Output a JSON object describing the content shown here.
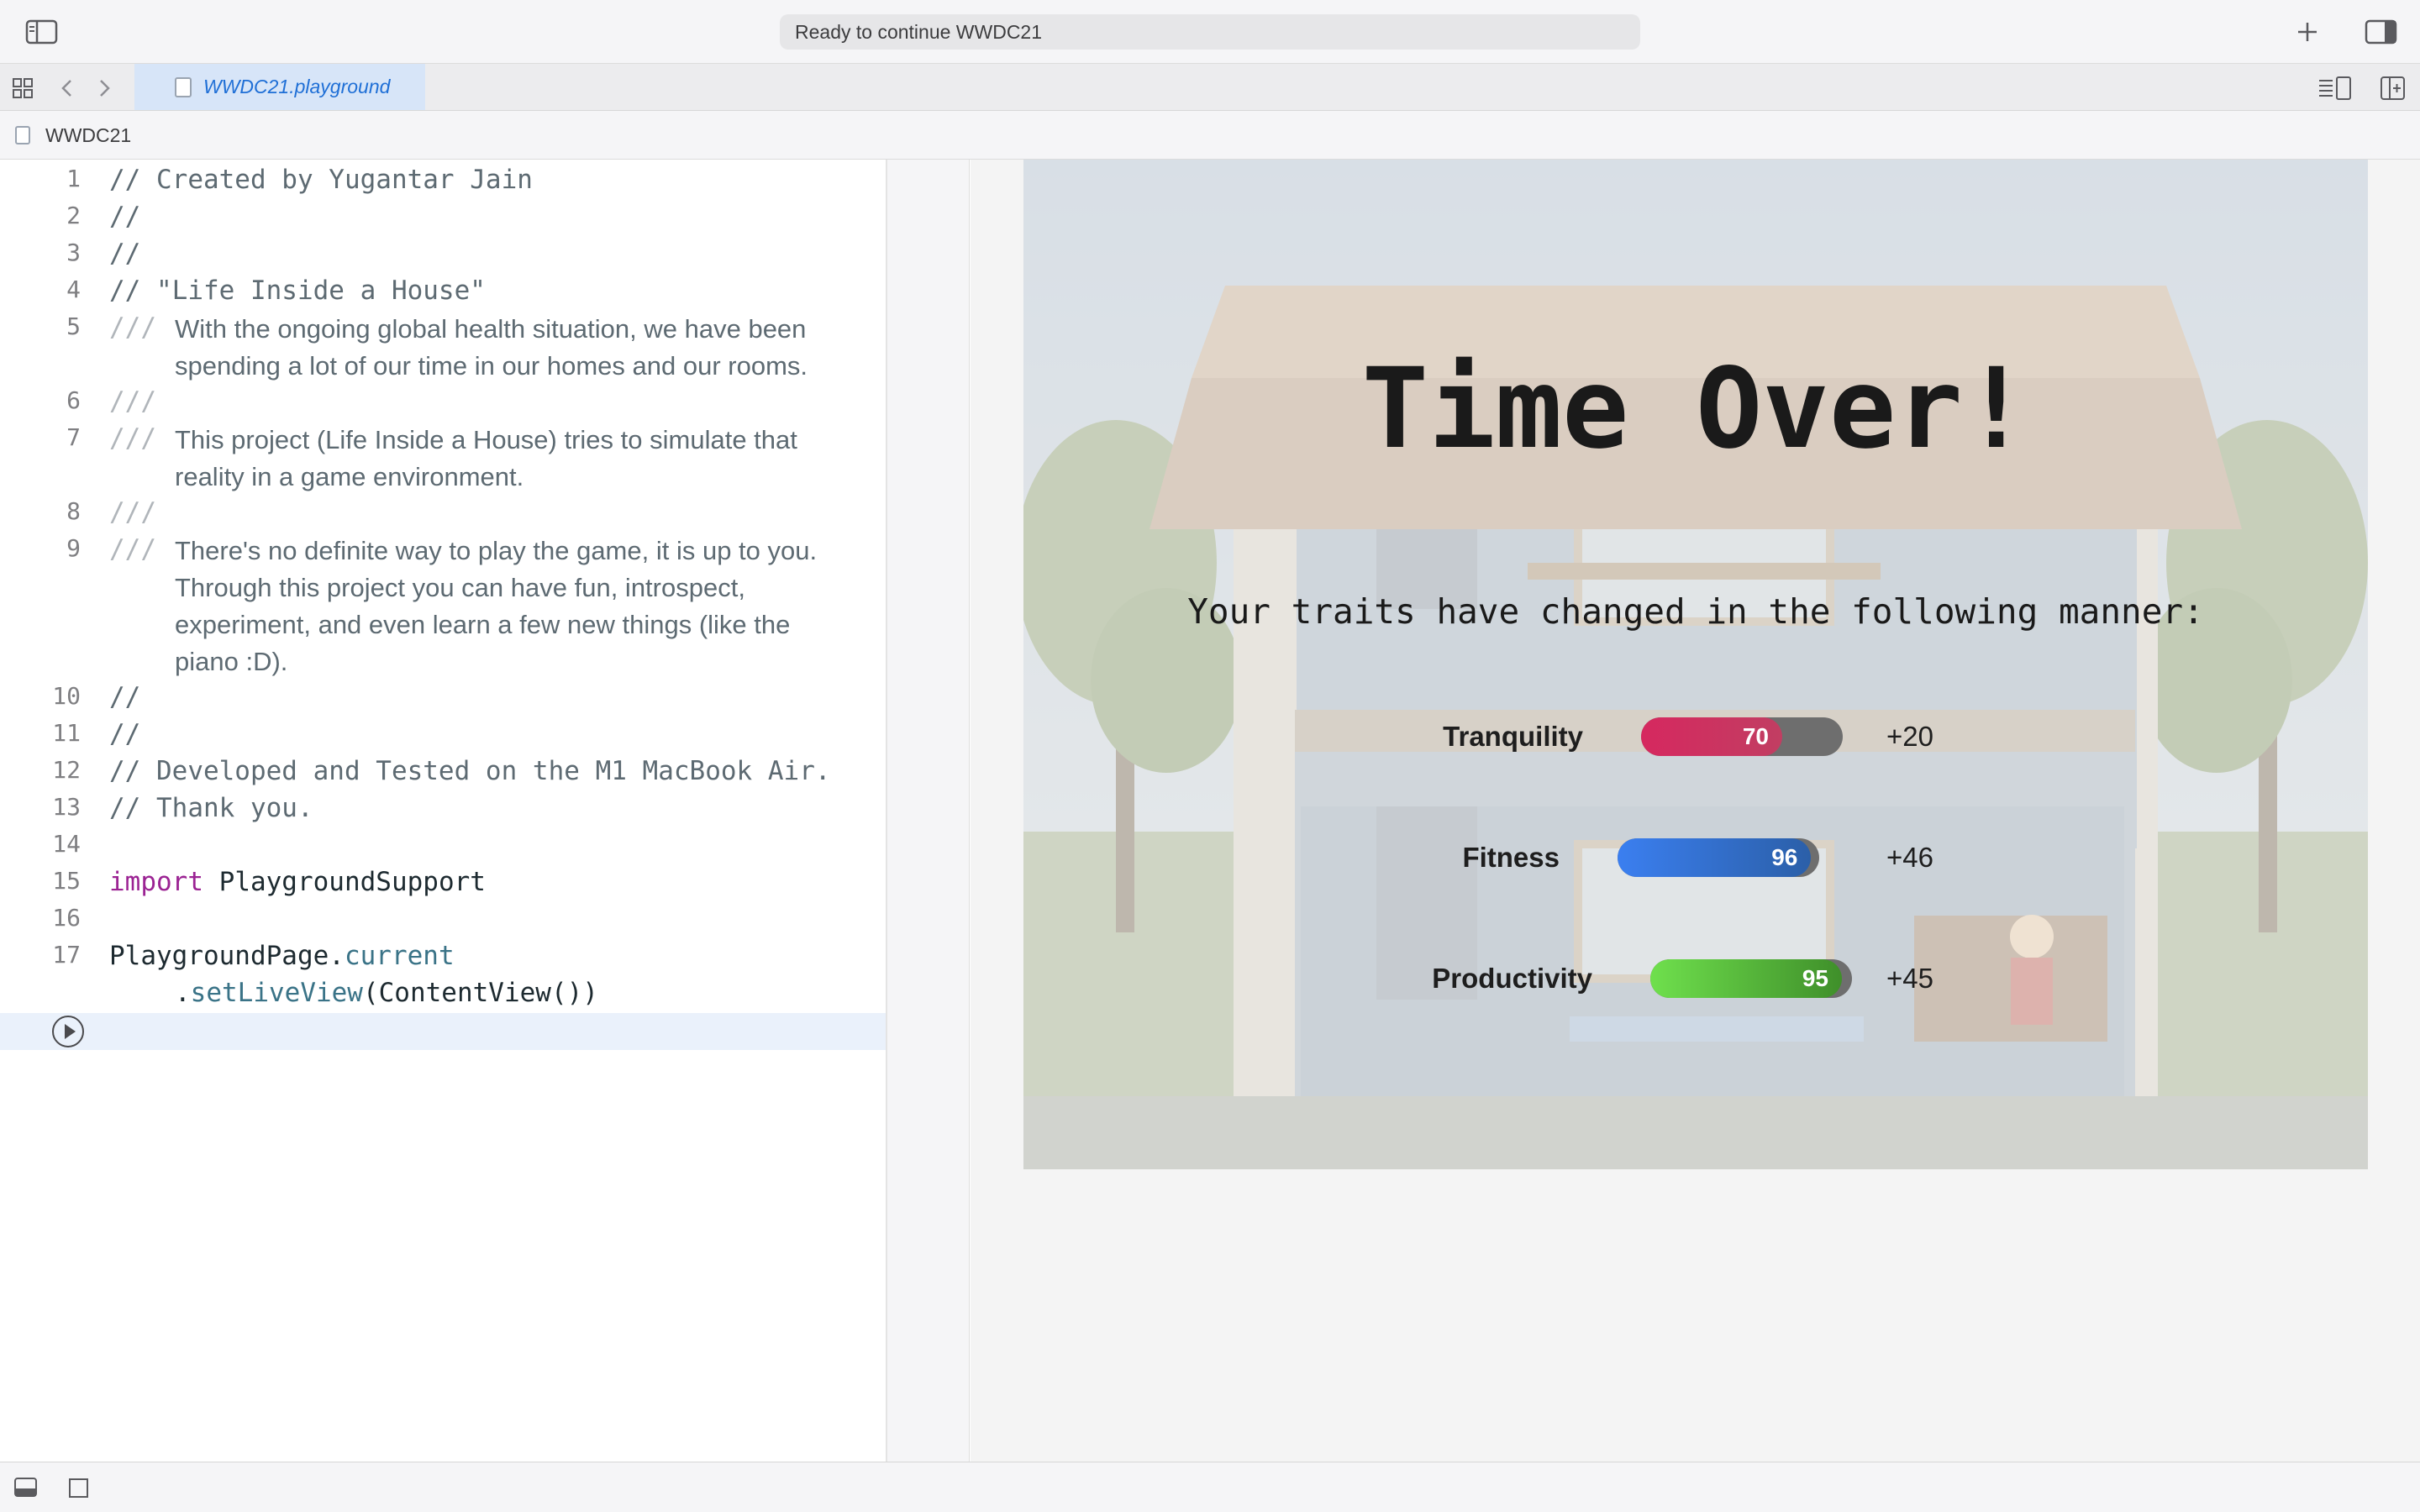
{
  "toolbar": {
    "status": "Ready to continue WWDC21",
    "sidebar_icon": "sidebar-left-icon",
    "add_icon": "plus-icon",
    "inspector_icon": "sidebar-right-icon"
  },
  "tabs": [
    {
      "label": "WWDC21.playground",
      "active": true
    }
  ],
  "breadcrumb": {
    "label": "WWDC21"
  },
  "editor": {
    "lines": [
      {
        "num": "1",
        "text": "// Created by Yugantar Jain"
      },
      {
        "num": "2",
        "text": "//"
      },
      {
        "num": "3",
        "text": "//"
      },
      {
        "num": "4",
        "text": "// \"Life Inside a House\""
      },
      {
        "num": "5",
        "doc": [
          "With the ongoing global health situation, we have been",
          "spending a lot of our time in our homes and our rooms."
        ]
      },
      {
        "num": "6",
        "doc": []
      },
      {
        "num": "7",
        "doc": [
          "This project (Life Inside a House) tries to simulate that",
          "reality in a game environment."
        ]
      },
      {
        "num": "8",
        "doc": []
      },
      {
        "num": "9",
        "doc": [
          "There's no definite way to play the game, it is up to you.",
          "Through this project you can have fun, introspect,",
          "experiment, and even learn a few new things (like the",
          "piano :D)."
        ]
      },
      {
        "num": "10",
        "text": "//"
      },
      {
        "num": "11",
        "text": "//"
      },
      {
        "num": "12",
        "text": "// Developed and Tested on the M1 MacBook Air."
      },
      {
        "num": "13",
        "text": "// Thank you."
      },
      {
        "num": "14",
        "text": ""
      },
      {
        "num": "15",
        "keyword": "import",
        "module": "PlaygroundSupport"
      },
      {
        "num": "16",
        "text": ""
      },
      {
        "num": "17",
        "code1_obj": "PlaygroundPage",
        "code1_dot": ".",
        "code1_member": "current",
        "code2_dot": ".",
        "code2_member": "setLiveView",
        "code2_rest": "(ContentView())"
      }
    ],
    "doc_marker": "///"
  },
  "live_view": {
    "title": "Time Over!",
    "subtitle": "Your traits have changed in the following manner:",
    "traits": [
      {
        "name": "Tranquility",
        "value": 70,
        "value_label": "70",
        "delta": "+20",
        "color_start": "#d6285f",
        "color_end": "#c13e62"
      },
      {
        "name": "Fitness",
        "value": 96,
        "value_label": "96",
        "delta": "+46",
        "color_start": "#3b7ff0",
        "color_end": "#2b5fa8"
      },
      {
        "name": "Productivity",
        "value": 95,
        "value_label": "95",
        "delta": "+45",
        "color_start": "#6fe04d",
        "color_end": "#3f8f2a"
      }
    ]
  },
  "bottombar": {
    "icon1": "debug-area-icon",
    "icon2": "square-icon"
  }
}
